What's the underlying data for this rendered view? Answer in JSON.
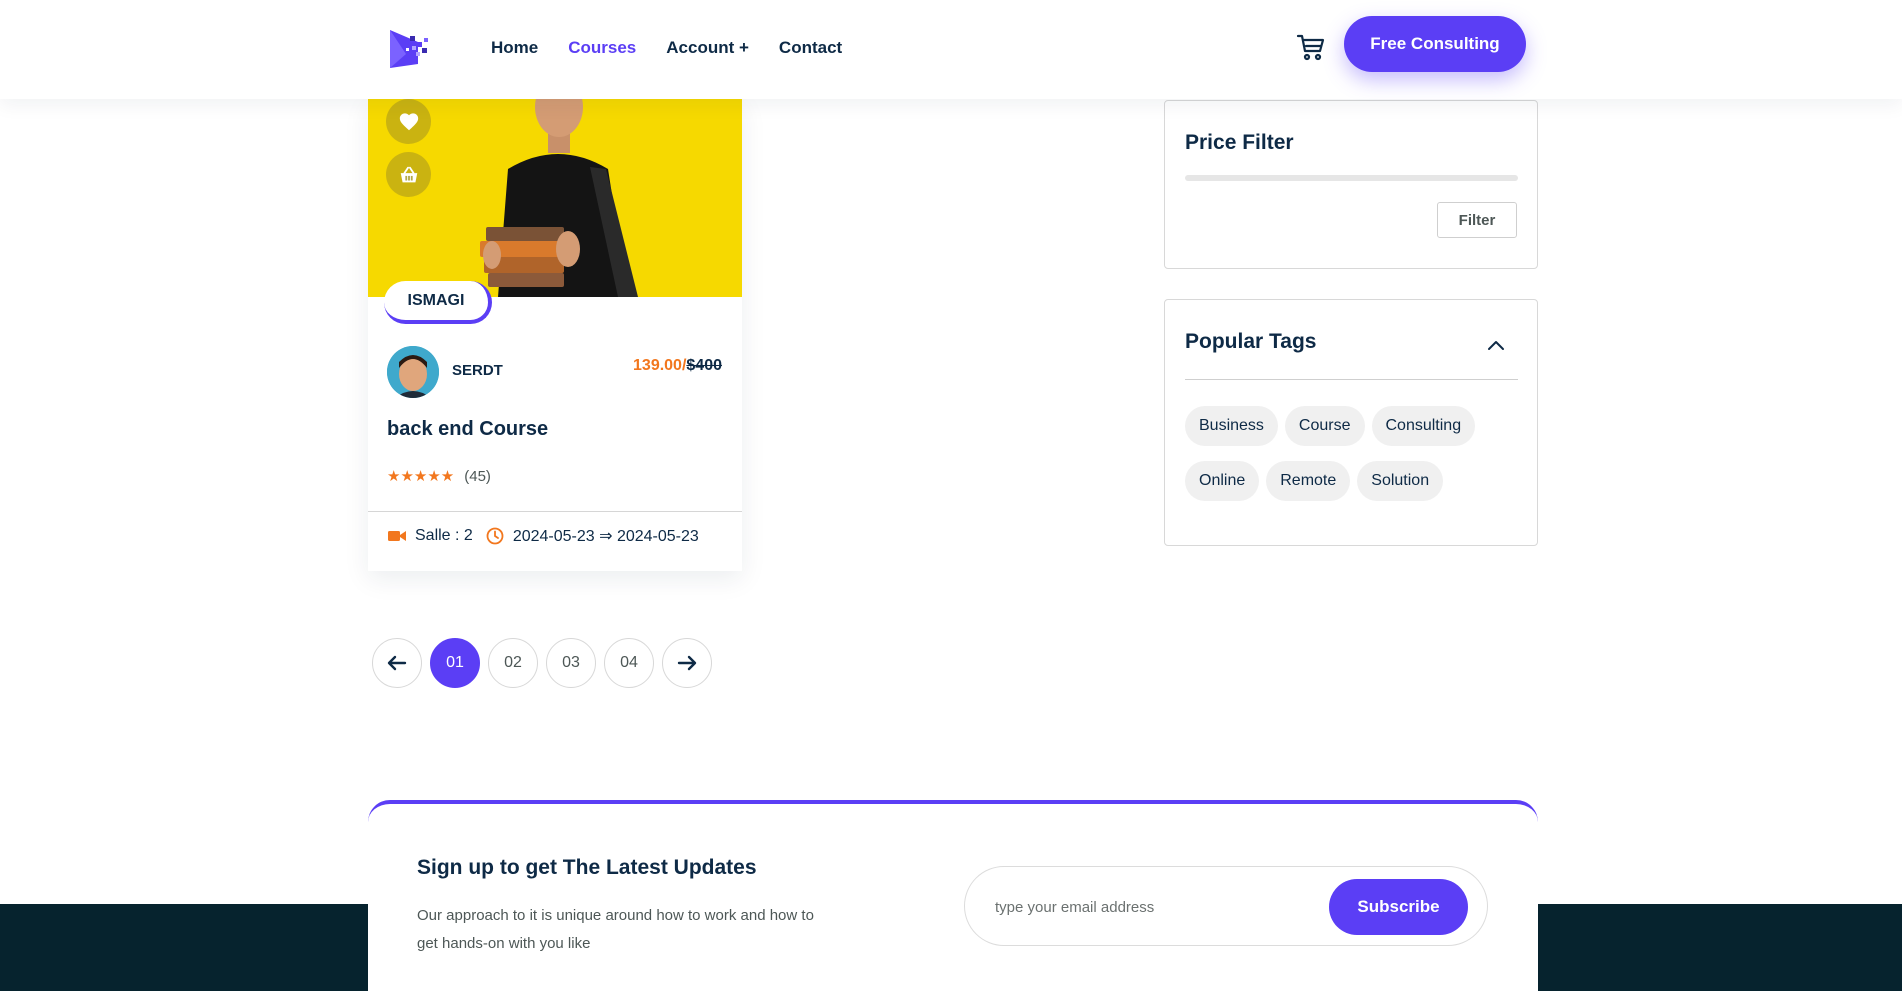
{
  "nav": {
    "items": [
      {
        "label": "Home",
        "active": false
      },
      {
        "label": "Courses",
        "active": true
      },
      {
        "label": "Account +",
        "active": false
      },
      {
        "label": "Contact",
        "active": false
      }
    ],
    "cta_label": "Free Consulting"
  },
  "course": {
    "category": "ISMAGI",
    "author": "SERDT",
    "price_current": "139.00/",
    "price_old": "$400",
    "title": "back end Course",
    "rating_count": "(45)",
    "room": "Salle : 2",
    "dates": "2024-05-23 ⇒ 2024-05-23"
  },
  "pagination": {
    "pages": [
      "01",
      "02",
      "03",
      "04"
    ],
    "active": "01"
  },
  "price_filter": {
    "title": "Price Filter",
    "button_label": "Filter"
  },
  "popular_tags": {
    "title": "Popular Tags",
    "tags": [
      "Business",
      "Course",
      "Consulting",
      "Online",
      "Remote",
      "Solution"
    ]
  },
  "newsletter": {
    "title": "Sign up to get The Latest Updates",
    "text": "Our approach to it is unique around how to work and how to get hands-on with you like",
    "placeholder": "type your email address",
    "button_label": "Subscribe"
  },
  "colors": {
    "accent": "#5b3ef5",
    "orange": "#f2771e",
    "dark": "#0e2a46",
    "footer": "#06232e",
    "card_image_bg": "#f6d900"
  },
  "icons": [
    "logo-icon",
    "cart-icon",
    "heart-icon",
    "basket-icon",
    "video-icon",
    "clock-icon",
    "arrow-left-icon",
    "arrow-right-icon",
    "chevron-up-icon"
  ]
}
